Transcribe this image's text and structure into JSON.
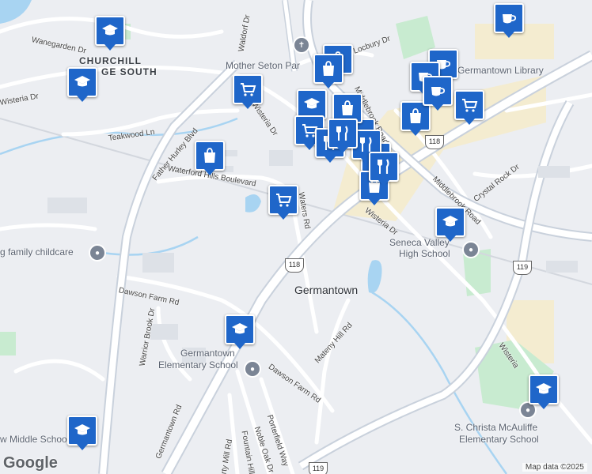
{
  "map": {
    "place_labels": {
      "churchill_1": "CHURCHILL",
      "churchill_2": "GE SOUTH",
      "germantown": "Germantown",
      "mother_seton": "Mother Seton Par",
      "library": "Germantown Library",
      "seneca_valley_1": "Seneca Valley",
      "seneca_valley_2": "High School",
      "germantown_es_1": "Germantown",
      "germantown_es_2": "Elementary School",
      "mcauliffe_1": "S. Christa McAuliffe",
      "mcauliffe_2": "Elementary School",
      "family_childcare": "g family childcare",
      "middle_school": "w Middle School"
    },
    "road_labels": {
      "wanegarden": "Wanegarden Dr",
      "wisteria_nw": "Wisteria Dr",
      "teakwood": "Teakwood Ln",
      "father_hurley": "Father Hurley Blvd",
      "waterford_hills": "Waterford Hills Boulevard",
      "waldorf": "Waldorf Dr",
      "locbury": "Locbury Dr",
      "middlebrook_n": "Middlebrook Road",
      "middlebrook_s": "Middlebrook Road",
      "wisteria_center": "Wisteria Dr",
      "wisteria_mid": "Wisteria Dr",
      "waters": "Waters Rd",
      "crystal_rock": "Crystal Rock Dr",
      "dawson_farm_w": "Dawson Farm Rd",
      "dawson_farm_e": "Dawson Farm Rd",
      "warrior_brook": "Warrior Brook Dr",
      "mateny_hill": "Mateny Hill Rd",
      "germantown_rd": "Germantown Rd",
      "porterfield": "Porterfield Way",
      "noble_oak": "Noble Oak Dr",
      "fountain_hills": "Fountain Hills",
      "liberty_mill": "erty Mill Rd",
      "wisteria_se": "Wisteria"
    },
    "route_shields": [
      "118",
      "118",
      "119",
      "119"
    ],
    "attribution": "Map data ©2025",
    "logo": "Google"
  },
  "markers": [
    {
      "type": "school"
    },
    {
      "type": "school"
    },
    {
      "type": "school"
    },
    {
      "type": "school"
    },
    {
      "type": "school"
    },
    {
      "type": "school"
    },
    {
      "type": "school"
    },
    {
      "type": "cart"
    },
    {
      "type": "cart"
    },
    {
      "type": "cart"
    },
    {
      "type": "cart"
    },
    {
      "type": "cart"
    },
    {
      "type": "bag"
    },
    {
      "type": "bag"
    },
    {
      "type": "bag"
    },
    {
      "type": "bag"
    },
    {
      "type": "bag"
    },
    {
      "type": "bag"
    },
    {
      "type": "bag"
    },
    {
      "type": "coffee"
    },
    {
      "type": "coffee"
    },
    {
      "type": "coffee"
    },
    {
      "type": "coffee"
    },
    {
      "type": "restaurant"
    },
    {
      "type": "restaurant"
    },
    {
      "type": "restaurant"
    },
    {
      "type": "restaurant"
    }
  ],
  "colors": {
    "marker": "#1f66c9",
    "water": "#a8d4f2",
    "park": "#c8ebd0",
    "commercial": "#f4ecd0",
    "road": "#ffffff",
    "highway": "#c9d1dc"
  }
}
